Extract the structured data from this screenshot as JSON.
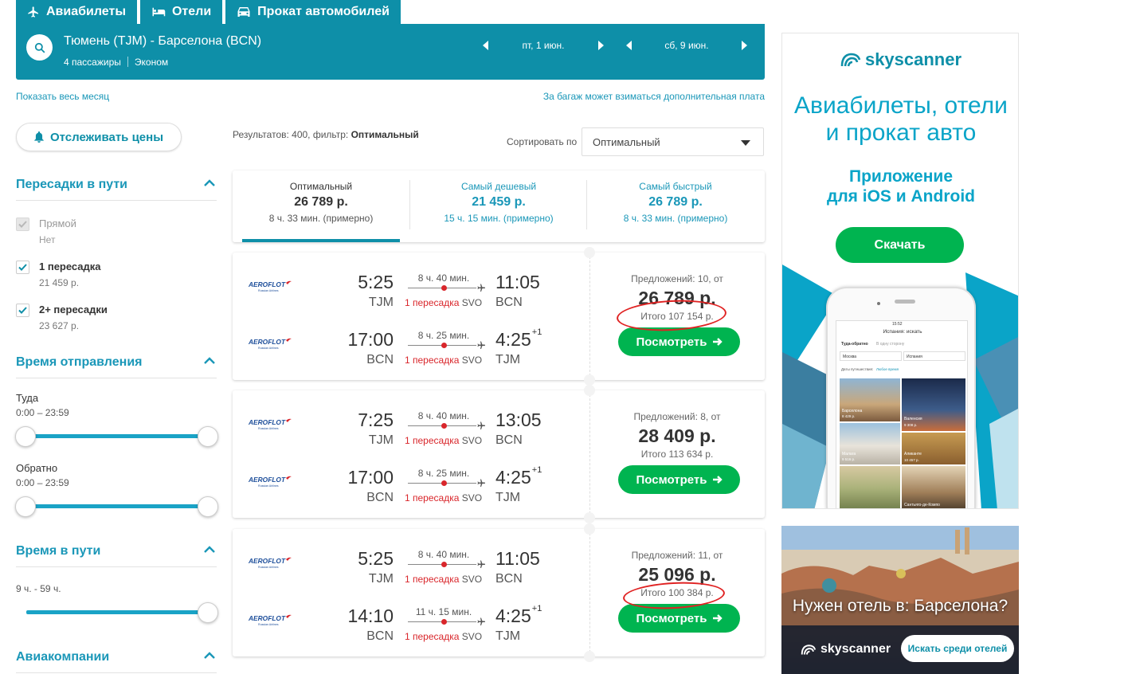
{
  "top_tabs": {
    "flights": "Авиабилеты",
    "hotels": "Отели",
    "cars": "Прокат автомобилей"
  },
  "search": {
    "route": "Тюмень (TJM) - Барселона (BCN)",
    "passengers": "4 пассажиры",
    "cabin": "Эконом",
    "depart_date": "пт, 1 июн.",
    "return_date": "сб, 9 июн."
  },
  "links": {
    "show_month": "Показать весь месяц",
    "baggage_note": "За багаж может взиматься дополнительная плата"
  },
  "sidebar": {
    "watch_prices": "Отслеживать цены",
    "stops": {
      "title": "Пересадки в пути",
      "items": [
        {
          "label": "Прямой",
          "sub": "Нет"
        },
        {
          "label": "1 пересадка",
          "sub": "21 459 р."
        },
        {
          "label": "2+ пересадки",
          "sub": "23 627 р."
        }
      ]
    },
    "departure_time": {
      "title": "Время отправления",
      "outbound_label": "Туда",
      "outbound_range": "0:00 – 23:59",
      "return_label": "Обратно",
      "return_range": "0:00 – 23:59"
    },
    "duration": {
      "title": "Время в пути",
      "value": "9 ч. - 59 ч."
    },
    "airlines": {
      "title": "Авиакомпании"
    }
  },
  "results": {
    "count_text": "Результатов: 400, фильтр:",
    "filter_name": "Оптимальный",
    "sort_label": "Сортировать по",
    "sort_value": "Оптимальный"
  },
  "sort_tabs": [
    {
      "label": "Оптимальный",
      "price": "26 789 р.",
      "time": "8 ч. 33 мин. (примерно)"
    },
    {
      "label": "Самый дешевый",
      "price": "21 459 р.",
      "time": "15 ч. 15 мин. (примерно)"
    },
    {
      "label": "Самый быстрый",
      "price": "26 789 р.",
      "time": "8 ч. 33 мин. (примерно)"
    }
  ],
  "flights": [
    {
      "legs": [
        {
          "airline": "AEROFLOT",
          "airline_sub": "Russian Airlines",
          "dep_time": "5:25",
          "dep_airport": "TJM",
          "duration": "8 ч. 40 мин.",
          "stops": "1 пересадка",
          "via": "SVO",
          "arr_time": "11:05",
          "arr_airport": "BCN",
          "day_offset": ""
        },
        {
          "airline": "AEROFLOT",
          "airline_sub": "Russian Airlines",
          "dep_time": "17:00",
          "dep_airport": "BCN",
          "duration": "8 ч. 25 мин.",
          "stops": "1 пересадка",
          "via": "SVO",
          "arr_time": "4:25",
          "arr_airport": "TJM",
          "day_offset": "+1"
        }
      ],
      "offers": "Предложений: 10, от",
      "price": "26 789 р.",
      "total": "Итого 107 154 р.",
      "button": "Посмотреть"
    },
    {
      "legs": [
        {
          "airline": "AEROFLOT",
          "airline_sub": "Russian Airlines",
          "dep_time": "7:25",
          "dep_airport": "TJM",
          "duration": "8 ч. 40 мин.",
          "stops": "1 пересадка",
          "via": "SVO",
          "arr_time": "13:05",
          "arr_airport": "BCN",
          "day_offset": ""
        },
        {
          "airline": "AEROFLOT",
          "airline_sub": "Russian Airlines",
          "dep_time": "17:00",
          "dep_airport": "BCN",
          "duration": "8 ч. 25 мин.",
          "stops": "1 пересадка",
          "via": "SVO",
          "arr_time": "4:25",
          "arr_airport": "TJM",
          "day_offset": "+1"
        }
      ],
      "offers": "Предложений: 8, от",
      "price": "28 409 р.",
      "total": "Итого 113 634 р.",
      "button": "Посмотреть"
    },
    {
      "legs": [
        {
          "airline": "AEROFLOT",
          "airline_sub": "Russian Airlines",
          "dep_time": "5:25",
          "dep_airport": "TJM",
          "duration": "8 ч. 40 мин.",
          "stops": "1 пересадка",
          "via": "SVO",
          "arr_time": "11:05",
          "arr_airport": "BCN",
          "day_offset": ""
        },
        {
          "airline": "AEROFLOT",
          "airline_sub": "Russian Airlines",
          "dep_time": "14:10",
          "dep_airport": "BCN",
          "duration": "11 ч. 15 мин.",
          "stops": "1 пересадка",
          "via": "SVO",
          "arr_time": "4:25",
          "arr_airport": "TJM",
          "day_offset": "+1"
        }
      ],
      "offers": "Предложений: 11, от",
      "price": "25 096 р.",
      "total": "Итого 100 384 р.",
      "button": "Посмотреть"
    }
  ],
  "ad": {
    "logo": "skyscanner",
    "headline_1": "Авиабилеты, отели",
    "headline_2": "и прокат авто",
    "sub_1": "Приложение",
    "sub_2": "для iOS и Android",
    "button": "Скачать",
    "phone": {
      "title": "Испания: искать",
      "tab_1": "Туда-обратно",
      "tab_2": "В одну сторону",
      "from": "Москва",
      "to": "Испания",
      "dates_label": "Даты путешествия:",
      "dates_value": "Любое время",
      "cities": [
        {
          "name": "Барселона",
          "price": "8 429 р."
        },
        {
          "name": "Валенсия",
          "price": "9 308 р."
        },
        {
          "name": "Малага",
          "price": "9 516 р."
        },
        {
          "name": "Аликанте",
          "price": "10 457 р."
        },
        {
          "name": "Сантьяго-де-Компо",
          "price": ""
        }
      ],
      "time": "15:52"
    }
  },
  "ad2": {
    "title": "Нужен отель в: Барселона?",
    "logo": "skyscanner",
    "button": "Искать среди отелей"
  },
  "colors": {
    "brand_teal": "#0e8fa8",
    "cta_green": "#00b450",
    "link_blue": "#1a97b8",
    "stop_red": "#d9262b"
  }
}
